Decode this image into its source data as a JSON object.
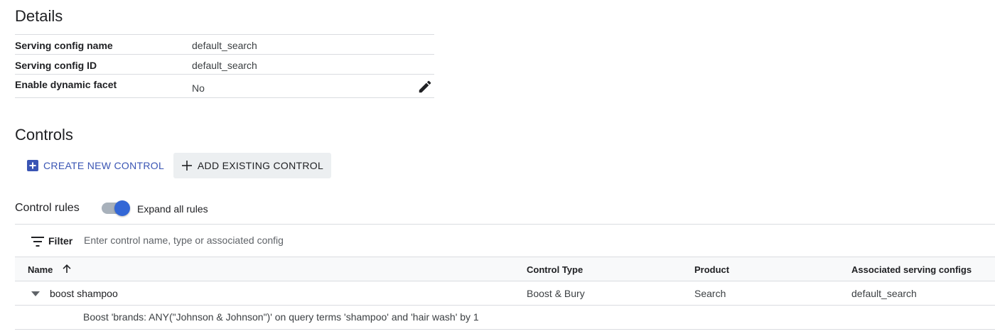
{
  "details": {
    "title": "Details",
    "rows": [
      {
        "label": "Serving config name",
        "value": "default_search"
      },
      {
        "label": "Serving config ID",
        "value": "default_search"
      },
      {
        "label": "Enable dynamic facet",
        "value": "No"
      }
    ]
  },
  "controls": {
    "title": "Controls",
    "create_label": "CREATE NEW CONTROL",
    "add_label": "ADD EXISTING CONTROL",
    "accent_color": "#3a55b4"
  },
  "rules": {
    "label": "Control rules",
    "toggle_label": "Expand all rules",
    "toggle_on": true
  },
  "filter": {
    "label": "Filter",
    "placeholder": "Enter control name, type or associated config",
    "value": ""
  },
  "table": {
    "columns": [
      "Name",
      "Control Type",
      "Product",
      "Associated serving configs"
    ],
    "rows": [
      {
        "name": "boost shampoo",
        "type": "Boost & Bury",
        "product": "Search",
        "configs": "default_search",
        "detail": "Boost 'brands: ANY(\"Johnson & Johnson\")' on query terms 'shampoo' and 'hair wash' by 1"
      }
    ]
  }
}
